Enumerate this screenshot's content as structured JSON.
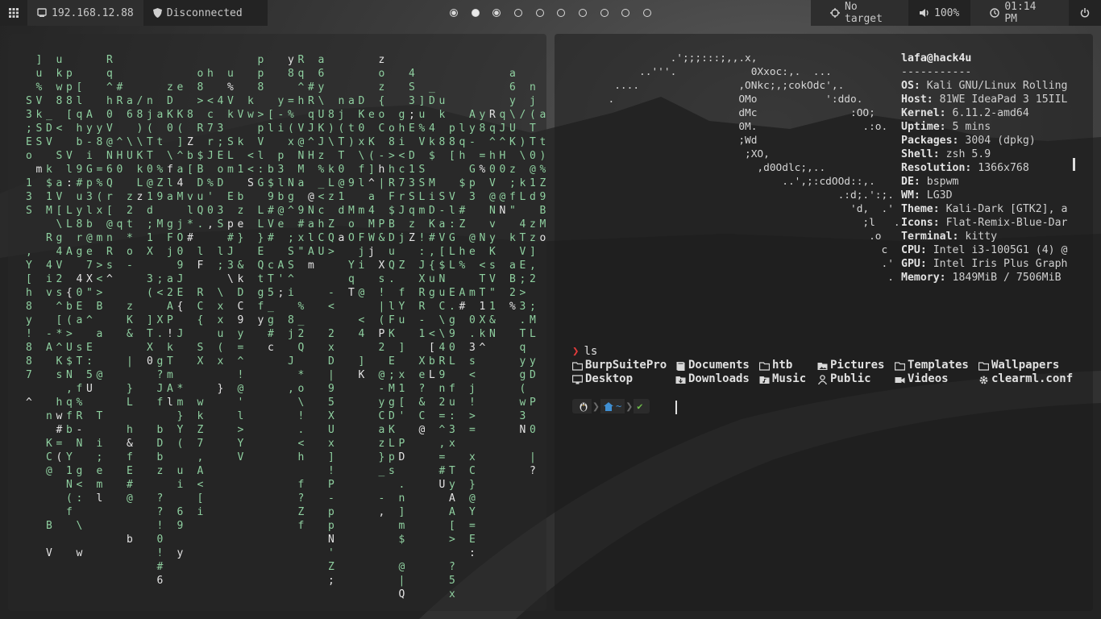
{
  "topbar": {
    "ip": "192.168.12.88",
    "vpn_status": "Disconnected",
    "workspaces": [
      "occupied",
      "active",
      "occupied",
      "empty",
      "empty",
      "empty",
      "empty",
      "empty",
      "empty",
      "empty"
    ],
    "target": "No target",
    "volume": "100%",
    "time": "01:14 PM"
  },
  "matrix": {
    "color": "#8fd0a0",
    "highlight_color": "#e4e4e4",
    "columns": [
      "4S3;EoD13S",
      "]u%VkSSLmj",
      "_DV4k$1M",
      "ukw8M<<S-aV[",
      "pp8[>pVl:GLLL",
      "[lqhb$9#",
      "Ay-iGp3lb@e",
      "y8==%(xbmN",
      "Rq^h0V@N",
      "#RqJ^H0V@N",
      "a6y\\UKJz",
      "/8)\\KkLz",
      "nj(TT0@1d",
      "a t)%Z9BMoOz",
      "zDK0x\\flamgFj",
      "eIK(]^a4MWjO0",
      "z",
      "o8>hRF$BDuQ.3lFK",
      "ghi<c7rJ"
    ],
    "grid": [
      "   4 ]  _       u       A           #    a /        n     a       z  e        z       o  8  > h",
      "   S u D     k p       y          R    6 8        j     t       D  I                R  F  $ B",
      "   3 % V     w 8       -          q    y )        (     )       K  (                D  u  Q . <",
      "     ; 4     M [ P     i          J    \\ \\    T       %       0  ]                3  l  F K =",
      "     E k     > E D     p =        ^    U K    ]       Z       x  \\                g  O  E 5 %",
      "     o S     < p 3     l (% $     0    H J    0       9       ^  a                P  #  ^ r J K",
      "     D $     S l b     h E B      V    g a    T       B       4  f                E  .    & I",
      "     1 1     - O W     @ # a s    Y    l L    @       M       l  W                X  5  * '",
      "     3 L     a [ :     > % 6 R    N    J z    1       o       a  ]                9     z X",
      "     I m     V x e     o C ^ 8    :    ` z    l       g       g  ]                ^     _ L",
      "       S j   [ G L     v q % #    :      d    5       x       j  0  r      %      )     W Y"
    ],
    "white_chars": [
      {
        "col": 3,
        "row": 2,
        "ch": "3"
      },
      {
        "col": 22,
        "row": 8,
        "ch": "T"
      }
    ]
  },
  "neofetch": {
    "art": [
      "               .';;;:::;,,.x,",
      "          ..'''.            0Xxoc:,.  ...",
      "      ....                ,ONkc;,;cokOdc',.",
      "     .                    OMo           ':ddo.",
      "                          dMc               :OO;",
      "                          0M.                 .:o.",
      "                          ;Wd",
      "                           ;XO,",
      "                             ,d0Odlc;,..",
      "                                 ..',;:cdOOd::,.",
      "                                          .:d;.':;.",
      "                                            'd,  .'",
      "                                              ;l   ..",
      "                                               .o",
      "                                                 c",
      "                                                 .'",
      "                                                  ."
    ],
    "user_host": "lafa@hack4u",
    "separator": "-----------",
    "info": [
      {
        "key": "OS",
        "value": "Kali GNU/Linux Rolling"
      },
      {
        "key": "Host",
        "value": "81WE IdeaPad 3 15IIL"
      },
      {
        "key": "Kernel",
        "value": "6.11.2-amd64"
      },
      {
        "key": "Uptime",
        "value": "5 mins"
      },
      {
        "key": "Packages",
        "value": "3004 (dpkg)"
      },
      {
        "key": "Shell",
        "value": "zsh 5.9"
      },
      {
        "key": "Resolution",
        "value": "1366x768"
      },
      {
        "key": "DE",
        "value": "bspwm"
      },
      {
        "key": "WM",
        "value": "LG3D"
      },
      {
        "key": "Theme",
        "value": "Kali-Dark [GTK2], a"
      },
      {
        "key": "Icons",
        "value": "Flat-Remix-Blue-Dar"
      },
      {
        "key": "Terminal",
        "value": "kitty"
      },
      {
        "key": "CPU",
        "value": "Intel i3-1005G1 (4) @"
      },
      {
        "key": "GPU",
        "value": "Intel Iris Plus Graph"
      },
      {
        "key": "Memory",
        "value": "1849MiB / 7506MiB"
      }
    ]
  },
  "terminal": {
    "command": "ls",
    "ls_rows": [
      [
        {
          "name": "BurpSuitePro",
          "icon": "folder-icon"
        },
        {
          "name": "Documents",
          "icon": "book-icon"
        },
        {
          "name": "htb",
          "icon": "folder-icon"
        },
        {
          "name": "Pictures",
          "icon": "image-folder-icon"
        },
        {
          "name": "Templates",
          "icon": "folder-icon"
        },
        {
          "name": "Wallpapers",
          "icon": "folder-icon"
        }
      ],
      [
        {
          "name": "Desktop",
          "icon": "desktop-icon"
        },
        {
          "name": "Downloads",
          "icon": "download-folder-icon"
        },
        {
          "name": "Music",
          "icon": "music-folder-icon"
        },
        {
          "name": "Public",
          "icon": "user-icon"
        },
        {
          "name": "Videos",
          "icon": "video-icon"
        },
        {
          "name": "clearml.conf",
          "icon": "gear-icon"
        }
      ]
    ],
    "prompt_dir": "~",
    "prompt_status": "✔",
    "accent_red": "#e23b3b",
    "accent_blue": "#3f8fd2",
    "accent_green": "#6fbf4a"
  }
}
